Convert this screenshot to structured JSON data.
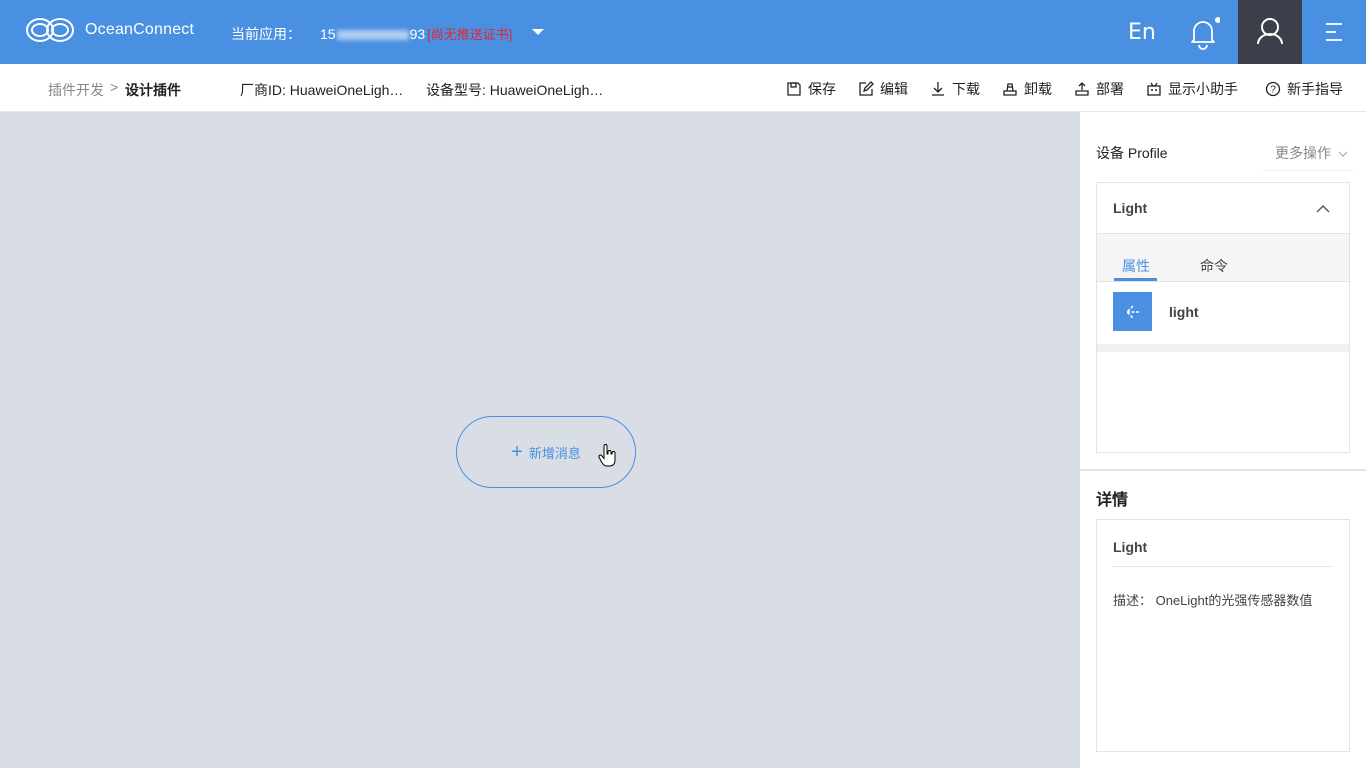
{
  "header": {
    "brand": "OceanConnect",
    "app_label": "当前应用：",
    "app_id_prefix": "15",
    "app_id_suffix": "93",
    "app_warning": "[尚无推送证书]",
    "lang": "En"
  },
  "subbar": {
    "crumb_parent": "插件开发",
    "crumb_sep": ">",
    "crumb_current": "设计插件",
    "vendor_id": "厂商ID: HuaweiOneLigh…",
    "device_model": "设备型号: HuaweiOneLigh…",
    "tools": {
      "save": "保存",
      "edit": "编辑",
      "download": "下载",
      "uninstall": "卸载",
      "deploy": "部署",
      "helper": "显示小助手",
      "guide": "新手指导"
    }
  },
  "canvas": {
    "add_label": "新增消息",
    "add_plus": "+"
  },
  "right_panel": {
    "title": "设备 Profile",
    "more": "更多操作",
    "profile": {
      "name": "Light",
      "tabs": [
        "属性",
        "命令"
      ],
      "active_tab": "属性",
      "properties": [
        {
          "name": "light"
        }
      ]
    },
    "details": {
      "title": "详情",
      "name": "Light",
      "description": "描述： OneLight的光强传感器数值"
    }
  },
  "colors": {
    "accent": "#4a90e2",
    "warning": "#e8242c",
    "canvas_bg": "#d9dee6",
    "user_box": "#3a3f4a"
  }
}
